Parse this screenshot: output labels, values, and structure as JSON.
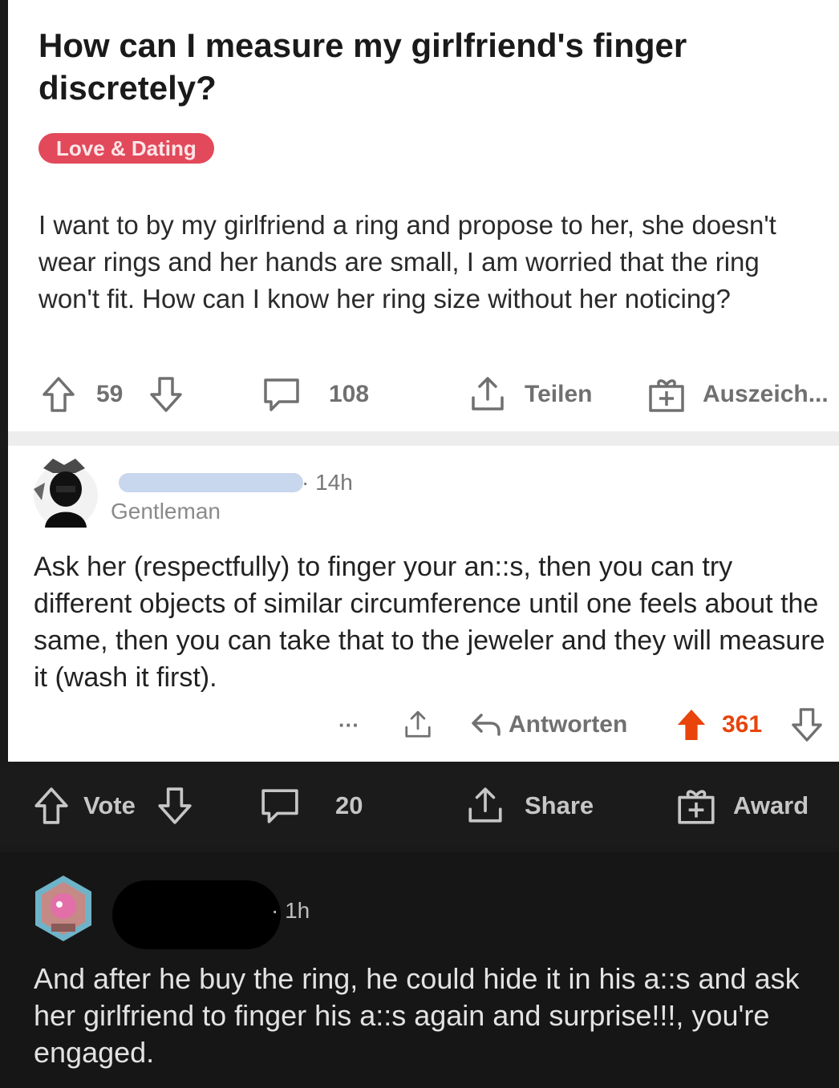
{
  "post": {
    "title": "How can I measure my girlfriend's finger discretely?",
    "flair": "Love & Dating",
    "body": "I want to by my girlfriend a ring and propose to her, she doesn't wear rings and her hands are small, I am worried that the ring won't fit. How can I know her ring size without her noticing?",
    "actions": {
      "votes": "59",
      "comments": "108",
      "share_label": "Teilen",
      "award_label": "Auszeich..."
    }
  },
  "comment": {
    "time": "· 14h",
    "user_flair": "Gentleman",
    "body": "Ask her (respectfully) to finger your an::s, then you can try different objects of similar circumference until one feels about the same, then you can take that to the jeweler and they will measure it (wash it first).",
    "actions": {
      "more": "···",
      "reply_label": "Antworten",
      "votes": "361"
    }
  },
  "dark_bar": {
    "vote_label": "Vote",
    "comments": "20",
    "share_label": "Share",
    "award_label": "Award"
  },
  "reply": {
    "time": "· 1h",
    "body": "And after he buy the ring, he could hide it in his a::s and ask her girlfriend to finger his a::s again and surprise!!!, you're engaged."
  },
  "colors": {
    "flair": "#e2495b",
    "upvote_active": "#e8440b",
    "dark_bg": "#1b1b1b"
  }
}
